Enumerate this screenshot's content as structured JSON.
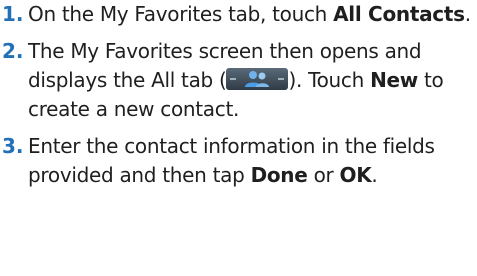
{
  "steps": [
    {
      "number": "1.",
      "parts": {
        "a": "On the My Favorites tab, touch ",
        "b": "All Contacts",
        "c": "."
      }
    },
    {
      "number": "2.",
      "parts": {
        "a": "The My Favorites screen then opens and displays the All tab (",
        "icon": "all-contacts-tab-icon",
        "b": "). Touch ",
        "c": "New",
        "d": " to create a new contact."
      }
    },
    {
      "number": "3.",
      "parts": {
        "a": "Enter the contact information in the fields provided and then tap ",
        "b": "Done",
        "c": " or ",
        "d": "OK",
        "e": "."
      }
    }
  ],
  "colors": {
    "step_number": "#2270b8",
    "text": "#1f1f1f"
  }
}
